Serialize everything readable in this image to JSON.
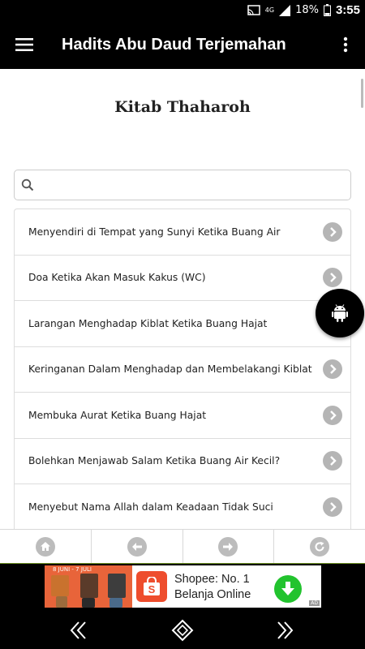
{
  "status_bar": {
    "network": "4G",
    "battery": "18%",
    "time": "3:55"
  },
  "app_bar": {
    "title": "Hadits Abu Daud Terjemahan",
    "menu_icon": "hamburger-icon",
    "overflow_icon": "more-vert-icon"
  },
  "page": {
    "section_title": "Kitab Thaharoh"
  },
  "search": {
    "placeholder": "",
    "value": ""
  },
  "list": {
    "items": [
      {
        "label": "Menyendiri di Tempat yang Sunyi Ketika Buang Air"
      },
      {
        "label": "Doa Ketika Akan Masuk Kakus (WC)"
      },
      {
        "label": "Larangan Menghadap Kiblat Ketika Buang Hajat"
      },
      {
        "label": "Keringanan Dalam Menghadap dan Membelakangi Kiblat"
      },
      {
        "label": "Membuka Aurat Ketika Buang Hajat"
      },
      {
        "label": "Bolehkan Menjawab Salam Ketika Buang Air Kecil?"
      },
      {
        "label": "Menyebut Nama Allah dalam Keadaan Tidak Suci"
      }
    ]
  },
  "fab": {
    "icon": "android-icon"
  },
  "bottom_nav": {
    "buttons": [
      "home-icon",
      "back-arrow-icon",
      "forward-arrow-icon",
      "refresh-icon"
    ]
  },
  "ad": {
    "image_text": "8 JUNI - 7 JULI",
    "headline": "Shopee: No. 1 Belanja Online",
    "badge": "AD",
    "brand_color": "#ee4d2d",
    "button_color": "#22c32e"
  },
  "colors": {
    "app_bar": "#000000",
    "arrow_circle": "#b5b5b5"
  }
}
